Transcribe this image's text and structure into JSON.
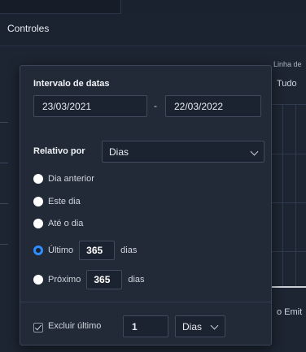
{
  "header": {
    "title": "Controles"
  },
  "background": {
    "col_right_top": "Linha de",
    "col_right_value": "Tudo",
    "col_right_bottom": "o Emit"
  },
  "popup": {
    "date_range": {
      "title": "Intervalo de datas",
      "start": "23/03/2021",
      "separator": "-",
      "end": "22/03/2022"
    },
    "relative": {
      "label": "Relativo por",
      "selected": "Dias"
    },
    "options": [
      {
        "label": "Dia anterior",
        "selected": false
      },
      {
        "label": "Este dia",
        "selected": false
      },
      {
        "label": "Até o dia",
        "selected": false
      },
      {
        "label": "Último",
        "value": "365",
        "suffix": "dias",
        "selected": true
      },
      {
        "label": "Próximo",
        "value": "365",
        "suffix": "dias",
        "selected": false
      }
    ],
    "exclude": {
      "label": "Excluir último",
      "value": "1",
      "unit": "Dias"
    }
  },
  "colors": {
    "accent": "#2f8dff",
    "background": "#1b2330",
    "panel": "#222a37"
  }
}
